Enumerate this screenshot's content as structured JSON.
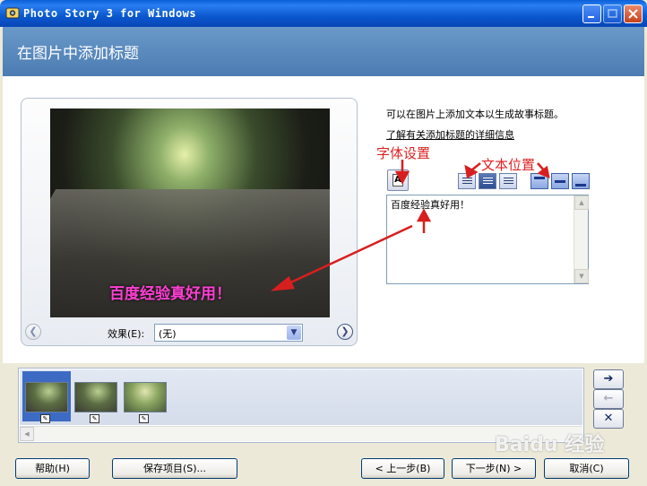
{
  "window": {
    "title": "Photo Story 3 for Windows"
  },
  "header": {
    "title": "在图片中添加标题"
  },
  "preview": {
    "caption": "百度经验真好用！",
    "effect_label": "效果(E):",
    "effect_value": "(无)"
  },
  "panel": {
    "info_text": "可以在图片上添加文本以生成故事标题。",
    "info_link": "了解有关添加标题的详细信息",
    "caption_text": "百度经验真好用！"
  },
  "annotations": {
    "font_settings": "字体设置",
    "text_position": "文本位置"
  },
  "buttons": {
    "help": "帮助(H)",
    "save_project": "保存项目(S)...",
    "back": "< 上一步(B)",
    "next": "下一步(N) >",
    "cancel": "取消(C)"
  },
  "watermark": "Baidu 经验",
  "colors": {
    "titlebar": "#0a58cf",
    "header": "#5a88bd",
    "caption": "#ff3fd4",
    "annotation": "#dd2222"
  }
}
